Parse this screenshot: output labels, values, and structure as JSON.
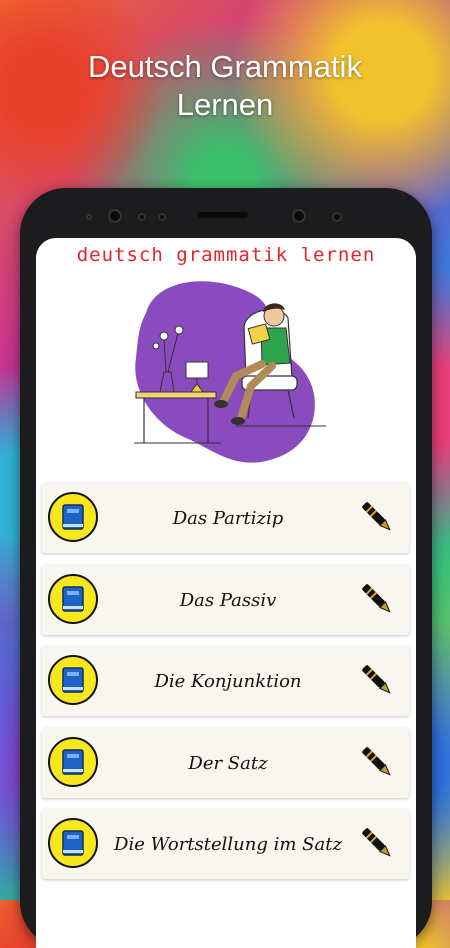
{
  "promo": {
    "title_line1": "Deutsch Grammatik",
    "title_line2": "Lernen"
  },
  "app": {
    "title": "deutsch grammatik lernen"
  },
  "colors": {
    "title_red": "#e3262c",
    "badge_yellow": "#f9e71d",
    "book_blue": "#1e63c7",
    "card_bg": "#f8f6ee",
    "blob_purple": "#8a4bbf"
  },
  "menu": {
    "items": [
      {
        "label": "Das Partizip",
        "icon": "book-icon",
        "action_icon": "pen-icon"
      },
      {
        "label": "Das Passiv",
        "icon": "book-icon",
        "action_icon": "pen-icon"
      },
      {
        "label": "Die Konjunktion",
        "icon": "book-icon",
        "action_icon": "pen-icon"
      },
      {
        "label": "Der Satz",
        "icon": "book-icon",
        "action_icon": "pen-icon"
      },
      {
        "label": "Die Wortstellung im Satz",
        "icon": "book-icon",
        "action_icon": "pen-icon"
      }
    ]
  }
}
